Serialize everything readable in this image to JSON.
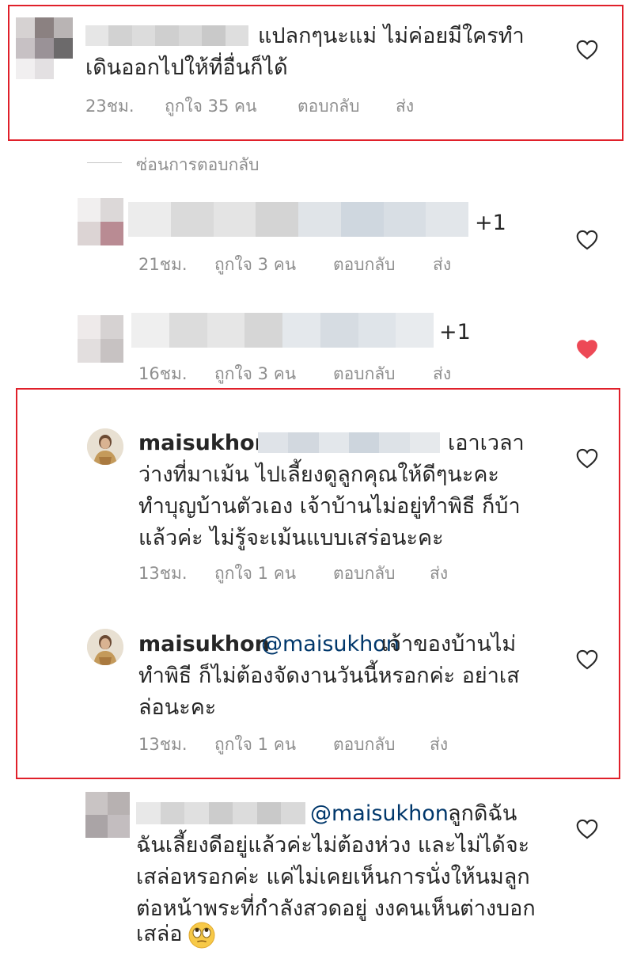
{
  "comments": [
    {
      "text_line1": "แปลกๆนะแม่ ไม่ค่อยมีใครทำ",
      "text_line2": "เดินออกไปให้ที่อื่นก็ได้",
      "time": "23ชม.",
      "likes": "ถูกใจ 35 คน",
      "reply": "ตอบกลับ",
      "send": "ส่ง"
    },
    {
      "suffix": "+1",
      "time": "21ชม.",
      "likes": "ถูกใจ 3 คน",
      "reply": "ตอบกลับ",
      "send": "ส่ง"
    },
    {
      "suffix": "+1",
      "time": "16ชม.",
      "likes": "ถูกใจ 3 คน",
      "reply": "ตอบกลับ",
      "send": "ส่ง",
      "liked": true
    },
    {
      "username": "maisukhon",
      "text_line1_end": "เอาเวลา",
      "text_line2": "ว่างที่มาเม้น ไปเลี้ยงดูลูกคุณให้ดีๆนะคะ",
      "text_line3": "ทำบุญบ้านตัวเอง เจ้าบ้านไม่อยู่ทำพิธี ก็บ้า",
      "text_line4": "แล้วค่ะ ไม่รู้จะเม้นแบบเสร่อนะคะ",
      "time": "13ชม.",
      "likes": "ถูกใจ 1 คน",
      "reply": "ตอบกลับ",
      "send": "ส่ง"
    },
    {
      "username": "maisukhon",
      "mention": "@maisukhon",
      "text_line1_end": "เจ้าของบ้านไม่",
      "text_line2": "ทำพิธี ก็ไม่ต้องจัดงานวันนี้หรอกค่ะ อย่าเส",
      "text_line3": "ล่อนะคะ",
      "time": "13ชม.",
      "likes": "ถูกใจ 1 คน",
      "reply": "ตอบกลับ",
      "send": "ส่ง"
    },
    {
      "mention": "@maisukhon",
      "text_line1_end": "ลูกดิฉัน",
      "text_line2": "ฉันเลี้ยงดีอยู่แล้วค่ะไม่ต้องห่วง และไม่ได้จะ",
      "text_line3": "เสล่อหรอกค่ะ แค่ไม่เคยเห็นการนั่งให้นมลูก",
      "text_line4": "ต่อหน้าพระที่กำลังสวดอยู่ งงคนเห็นต่างบอก",
      "text_line5": "เสล่อ"
    }
  ],
  "hide_replies": "ซ่อนการตอบกลับ",
  "colors": {
    "highlight_border": "#e0202a",
    "liked_heart": "#ed4956",
    "meta_gray": "#8e8e8e",
    "mention_blue": "#00376b"
  }
}
